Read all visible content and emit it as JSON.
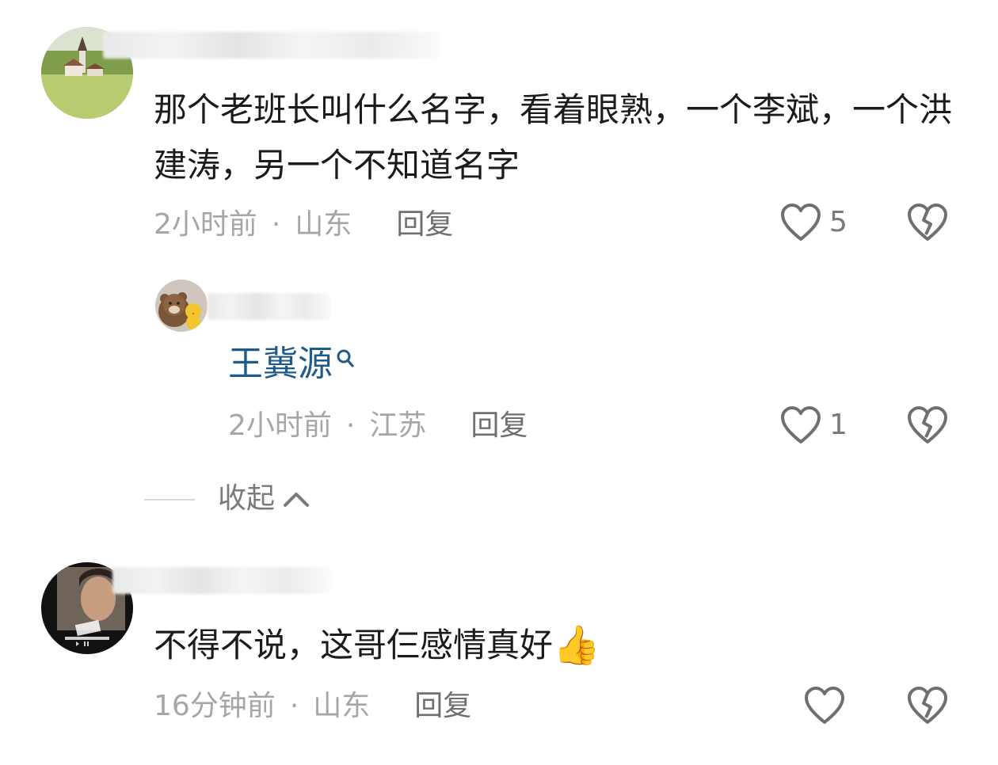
{
  "comments": [
    {
      "username": "155077?????????",
      "text": "那个老班长叫什么名字，看着眼熟，一个李斌，一个洪建涛，另一个不知道名字",
      "time": "2小时前",
      "location": "山东",
      "reply_label": "回复",
      "likes": "5",
      "avatar": "village-landscape"
    },
    {
      "username": "????",
      "mention": "王冀源",
      "time": "2小时前",
      "location": "江苏",
      "reply_label": "回复",
      "likes": "1",
      "avatar": "brown-bear-plush"
    },
    {
      "username": "??????",
      "text": "不得不说，这哥仨感情真好",
      "emoji": "👍",
      "time": "16分钟前",
      "location": "山东",
      "reply_label": "回复",
      "likes": "",
      "avatar": "album-cover"
    }
  ],
  "collapse_label": "收起",
  "separator": "·",
  "icons": {
    "like": "heart-outline-icon",
    "dislike": "broken-heart-icon",
    "search": "search-icon",
    "chevron": "chevron-up-icon"
  },
  "colors": {
    "text": "#1b1b1b",
    "meta": "#a6a6a6",
    "mention": "#1e5b88",
    "icon": "#6f6f6f"
  }
}
